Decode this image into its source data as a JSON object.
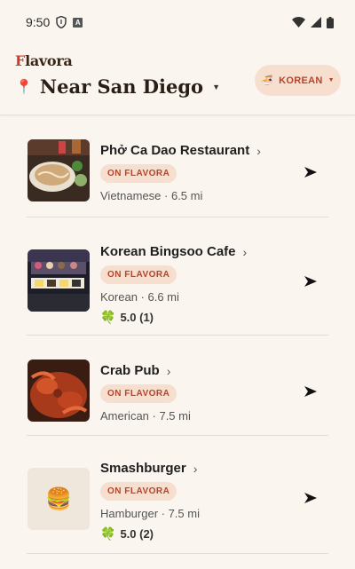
{
  "status": {
    "time": "9:50",
    "ime": "A"
  },
  "brand": {
    "logo_text": "Flavora",
    "logo_pin": "F",
    "logo_rest": "lavora"
  },
  "header": {
    "location": "Near San Diego",
    "cuisine_filter": "KOREAN"
  },
  "badge_label": "ON FLAVORA",
  "restaurants": [
    {
      "name": "Phở Ca Dao Restaurant",
      "badge": "ON FLAVORA",
      "meta": "Vietnamese · 6.5 mi"
    },
    {
      "name": "Korean Bingsoo Cafe",
      "badge": "ON FLAVORA",
      "meta": "Korean · 6.6 mi",
      "rating": "5.0 (1)"
    },
    {
      "name": "Crab Pub",
      "badge": "ON FLAVORA",
      "meta": "American · 7.5 mi"
    },
    {
      "name": "Smashburger",
      "badge": "ON FLAVORA",
      "meta": "Hamburger · 7.5 mi",
      "rating": "5.0 (2)"
    }
  ],
  "colors": {
    "accent": "#b6432a",
    "badge_bg": "#f7dfd0",
    "background": "#faf5ef"
  },
  "icons": [
    "shield-icon",
    "wifi-icon",
    "signal-icon",
    "battery-icon",
    "location-pin-icon",
    "noodle-bowl-icon",
    "navigate-arrow-icon",
    "clover-icon",
    "hamburger-icon"
  ]
}
